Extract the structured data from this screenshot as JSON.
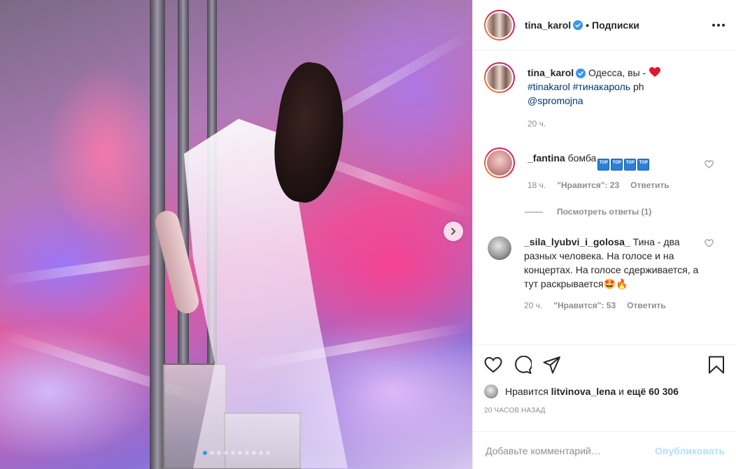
{
  "post": {
    "author": "tina_karol",
    "follow_label": "Подписки",
    "separator": "•"
  },
  "caption": {
    "author": "tina_karol",
    "text": "Одесса, вы -",
    "hashtag1": "#tinakarol",
    "hashtag2": "#тинакароль",
    "suffix": "ph",
    "mention": "@spromojna",
    "time": "20 ч."
  },
  "comments": [
    {
      "author": "_fantina",
      "text": "бомба",
      "top_emoji": "TOP",
      "time": "18 ч.",
      "likes": "\"Нравится\": 23",
      "reply": "Ответить",
      "view_replies": "Посмотреть ответы (1)"
    },
    {
      "author": "_sila_lyubvi_i_golosa_",
      "text": "Тина - два разных человека. На голосе и на концертах. На голосе сдерживается, а тут раскрывается🤩🔥",
      "time": "20 ч.",
      "likes": "\"Нравится\": 53",
      "reply": "Ответить"
    }
  ],
  "likes": {
    "prefix": "Нравится",
    "user": "litvinova_lena",
    "middle": "и",
    "rest": "ещё 60 306"
  },
  "timeago": "20 ЧАСОВ НАЗАД",
  "add_comment": {
    "placeholder": "Добавьте комментарий…",
    "publish": "Опубликовать"
  },
  "carousel": {
    "total_slides": 10,
    "active_slide": 1
  },
  "colors": {
    "verified": "#3897f0",
    "link": "#00376b",
    "muted": "#8e8e8e",
    "heart": "#ed4956",
    "publish_disabled": "#b2dffc"
  },
  "icons": [
    "heart-icon",
    "comment-icon",
    "share-icon",
    "bookmark-icon",
    "chevron-right-icon",
    "verified-badge-icon",
    "more-options-icon"
  ]
}
